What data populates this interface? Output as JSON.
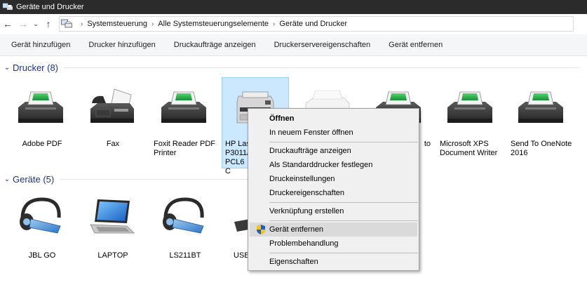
{
  "window": {
    "title": "Geräte und Drucker"
  },
  "nav": {
    "back": "←",
    "forward": "→",
    "recent": "⌄",
    "up": "↑"
  },
  "address": {
    "crumbs": [
      "Systemsteuerung",
      "Alle Systemsteuerungselemente",
      "Geräte und Drucker"
    ],
    "separator": "›"
  },
  "toolbar": {
    "items": [
      "Gerät hinzufügen",
      "Drucker hinzufügen",
      "Druckaufträge anzeigen",
      "Druckerservereigenschaften",
      "Gerät entfernen"
    ]
  },
  "groups": {
    "printers": {
      "title": "Drucker (8)",
      "chevron": "⌄"
    },
    "devices": {
      "title": "Geräte (5)",
      "chevron": "⌄"
    }
  },
  "printers": [
    {
      "label": "Adobe PDF",
      "icon": "printer-icon"
    },
    {
      "label": "Fax",
      "icon": "fax-icon"
    },
    {
      "label": "Foxit Reader PDF Printer",
      "icon": "printer-icon"
    },
    {
      "label": "HP LaserJet P3011/P3015 PCL6 Class Driver",
      "label_visible": "HP Las\nP3011/\nPCL6 C",
      "icon": "laser-printer-icon"
    },
    {
      "label": "",
      "icon": "white-printer-icon"
    },
    {
      "label": "to",
      "icon": "printer-icon"
    },
    {
      "label": "Microsoft XPS Document Writer",
      "icon": "printer-icon"
    },
    {
      "label": "Send To OneNote 2016",
      "icon": "printer-icon"
    }
  ],
  "devices": [
    {
      "label": "JBL GO",
      "icon": "headset-icon"
    },
    {
      "label": "LAPTOP",
      "icon": "laptop-icon"
    },
    {
      "label": "LS211BT",
      "icon": "headset-icon"
    },
    {
      "label": "USB",
      "icon": "keyboard-icon"
    }
  ],
  "context_menu": {
    "items": [
      {
        "label": "Öffnen",
        "bold": true
      },
      {
        "label": "In neuem Fenster öffnen"
      },
      {
        "label": "Druckaufträge anzeigen"
      },
      {
        "label": "Als Standarddrucker festlegen"
      },
      {
        "label": "Druckeinstellungen"
      },
      {
        "label": "Druckereigenschaften"
      },
      {
        "label": "Verknüpfung erstellen"
      },
      {
        "label": "Gerät entfernen",
        "shield": true,
        "highlighted": true
      },
      {
        "label": "Problembehandlung"
      },
      {
        "label": "Eigenschaften"
      }
    ]
  },
  "colors": {
    "group_title": "#1e3287",
    "selection_bg": "#cce8ff",
    "selection_border": "#99d1ff",
    "titlebar": "#2b2b2b"
  }
}
